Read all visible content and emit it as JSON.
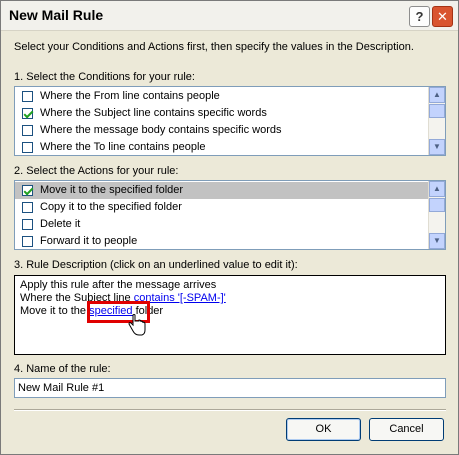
{
  "window": {
    "title": "New Mail Rule",
    "help_symbol": "?",
    "close_symbol": "✕"
  },
  "instructions": "Select your Conditions and Actions first, then specify the values in the Description.",
  "conditions": {
    "label": "1. Select the Conditions for your rule:",
    "items": [
      {
        "text": "Where the From line contains people",
        "checked": false
      },
      {
        "text": "Where the Subject line contains specific words",
        "checked": true
      },
      {
        "text": "Where the message body contains specific words",
        "checked": false
      },
      {
        "text": "Where the To line contains people",
        "checked": false
      }
    ]
  },
  "actions": {
    "label": "2. Select the Actions for your rule:",
    "items": [
      {
        "text": "Move it to the specified folder",
        "checked": true
      },
      {
        "text": "Copy it to the specified folder",
        "checked": false
      },
      {
        "text": "Delete it",
        "checked": false
      },
      {
        "text": "Forward it to people",
        "checked": false
      }
    ]
  },
  "description": {
    "label": "3. Rule Description (click on an underlined value to edit it):",
    "line1": "Apply this rule after the message arrives",
    "line2_prefix": "Where the Subject line ",
    "line2_link": "contains '[-SPAM-]'",
    "line3_prefix": "Move it to the ",
    "line3_link": "specified",
    "line3_suffix": " folder"
  },
  "rule_name": {
    "label": "4. Name of the rule:",
    "value": "New Mail Rule #1"
  },
  "buttons": {
    "ok": "OK",
    "cancel": "Cancel"
  },
  "colors": {
    "dialog_bg": "#ece9d8",
    "link": "#0000ee",
    "highlight": "#e00000",
    "selected_row": "#c2c2c2"
  },
  "icons": {
    "scroll_up": "▲",
    "scroll_down": "▼",
    "cursor": "hand-pointer-icon"
  }
}
